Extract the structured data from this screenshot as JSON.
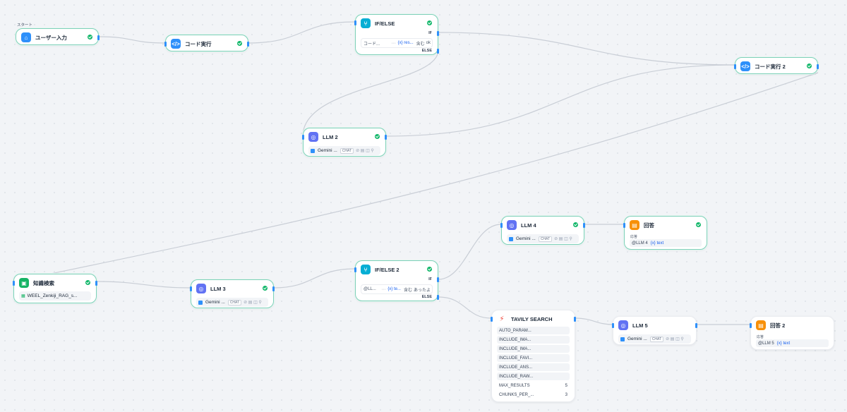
{
  "start_label": "スタート",
  "nodes": {
    "user_input": {
      "title": "ユーザー入力"
    },
    "code1": {
      "title": "コード実行"
    },
    "ifelse1": {
      "title": "IF/ELSE",
      "if": "IF",
      "else": "ELSE",
      "cond_var": "コード...",
      "cond_sep": "⋯",
      "cond_val": "{x} res...",
      "cond_op": "含む",
      "cond_rhs": "ok"
    },
    "code2": {
      "title": "コード実行 2"
    },
    "llm2": {
      "title": "LLM 2",
      "model": "Gemini ...",
      "mode": "CHAT"
    },
    "knowledge": {
      "title": "知識検索",
      "dataset": "WEEL_Zenkiji_RAG_s..."
    },
    "llm3": {
      "title": "LLM 3",
      "model": "Gemini ...",
      "mode": "CHAT"
    },
    "ifelse2": {
      "title": "IF/ELSE 2",
      "if": "IF",
      "else": "ELSE",
      "cond_var": "@LL...",
      "cond_sep": "⋯",
      "cond_val": "{x} te...",
      "cond_op": "含む",
      "cond_rhs": "あったよ"
    },
    "llm4": {
      "title": "LLM 4",
      "model": "Gemini ...",
      "mode": "CHAT"
    },
    "answer1": {
      "title": "回答",
      "sub": "応答",
      "ref": "@LLM 4",
      "refvar": "{x} text"
    },
    "tavily": {
      "title": "TAVILY SEARCH",
      "params": [
        {
          "name": "AUTO_PARAM...",
          "value": ""
        },
        {
          "name": "INCLUDE_IMA...",
          "value": ""
        },
        {
          "name": "INCLUDE_IMA...",
          "value": ""
        },
        {
          "name": "INCLUDE_FAVI...",
          "value": ""
        },
        {
          "name": "INCLUDE_ANS...",
          "value": ""
        },
        {
          "name": "INCLUDE_RAW...",
          "value": ""
        },
        {
          "name": "MAX_RESULTS",
          "value": "5"
        },
        {
          "name": "CHUNKS_PER_...",
          "value": "3"
        }
      ]
    },
    "llm5": {
      "title": "LLM 5",
      "model": "Gemini ...",
      "mode": "CHAT"
    },
    "answer2": {
      "title": "回答 2",
      "sub": "応答",
      "ref": "@LLM 5",
      "refvar": "{x} text"
    }
  },
  "icons": {
    "code": "code-icon",
    "branch": "branch-icon",
    "llm": "llm-brain-icon",
    "home": "home-icon",
    "knowledge": "book-icon",
    "answer": "answer-icon",
    "tavily": "tavily-logo-icon",
    "check": "check-circle-icon"
  },
  "colors": {
    "selected_border": "#7fd0b9",
    "check": "#12b76a",
    "code_icon": "#2e90fa",
    "branch_icon": "#06aed4",
    "llm_icon": "#6172f3",
    "knowledge_icon": "#16b364",
    "answer_icon": "#f79009",
    "variable": "#155eef"
  }
}
